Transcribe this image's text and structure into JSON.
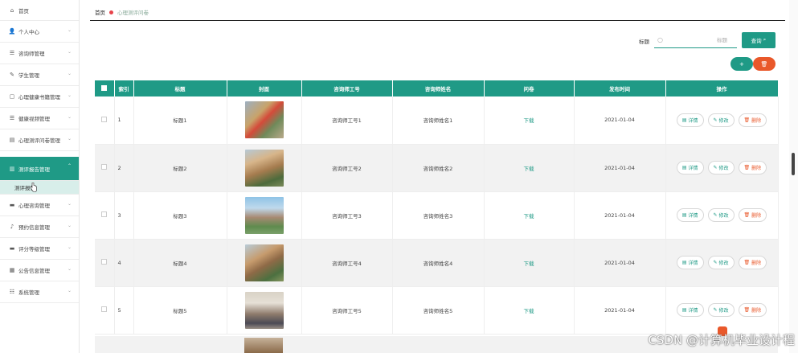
{
  "sidebar": {
    "home": "首页",
    "items": [
      {
        "label": "个人中心",
        "icon": "user-icon",
        "glyph": "👤"
      },
      {
        "label": "咨询师管理",
        "icon": "list-icon",
        "glyph": "☰"
      },
      {
        "label": "学生管理",
        "icon": "student-icon",
        "glyph": "✎"
      },
      {
        "label": "心理健康书籍管理",
        "icon": "book-icon",
        "glyph": "▢"
      },
      {
        "label": "健康视频管理",
        "icon": "video-icon",
        "glyph": "☰"
      },
      {
        "label": "心理测评问卷管理",
        "icon": "survey-icon",
        "glyph": "▤"
      }
    ],
    "active": {
      "label": "测评报告管理",
      "icon": "report-icon",
      "glyph": "▥"
    },
    "active_sub": "测评报告",
    "items_after": [
      {
        "label": "心理咨询管理",
        "icon": "chat-icon",
        "glyph": "▬"
      },
      {
        "label": "预约信息管理",
        "icon": "bell-icon",
        "glyph": "♪"
      },
      {
        "label": "评分等级管理",
        "icon": "star-icon",
        "glyph": "▬"
      },
      {
        "label": "公告信息管理",
        "icon": "notice-icon",
        "glyph": "▦"
      },
      {
        "label": "系统管理",
        "icon": "settings-icon",
        "glyph": "☷"
      }
    ]
  },
  "breadcrumb": {
    "home": "首页",
    "current": "心理测评问卷"
  },
  "search": {
    "label": "标题",
    "placeholder": "标题",
    "button": "查询"
  },
  "actions": {
    "add": "+",
    "delete": "🗑"
  },
  "table": {
    "headers": [
      "索引",
      "标题",
      "封面",
      "咨询师工号",
      "咨询师姓名",
      "问卷",
      "发布时间",
      "操作"
    ],
    "rows": [
      {
        "index": "1",
        "title": "标题1",
        "cover": "c1",
        "teacher_no": "咨询师工号1",
        "teacher_name": "咨询师姓名1",
        "file": "下载",
        "date": "2021-01-04"
      },
      {
        "index": "2",
        "title": "标题2",
        "cover": "c2",
        "teacher_no": "咨询师工号2",
        "teacher_name": "咨询师姓名2",
        "file": "下载",
        "date": "2021-01-04"
      },
      {
        "index": "3",
        "title": "标题3",
        "cover": "c3",
        "teacher_no": "咨询师工号3",
        "teacher_name": "咨询师姓名3",
        "file": "下载",
        "date": "2021-01-04"
      },
      {
        "index": "4",
        "title": "标题4",
        "cover": "c4",
        "teacher_no": "咨询师工号4",
        "teacher_name": "咨询师姓名4",
        "file": "下载",
        "date": "2021-01-04"
      },
      {
        "index": "5",
        "title": "标题5",
        "cover": "c5",
        "teacher_no": "咨询师工号5",
        "teacher_name": "咨询师姓名5",
        "file": "下载",
        "date": "2021-01-04"
      }
    ],
    "ops": {
      "detail": "详情",
      "edit": "修改",
      "delete": "删除"
    }
  },
  "watermark": "CSDN @计算机毕业设计程",
  "colors": {
    "primary": "#1f9a86",
    "danger": "#e9582a",
    "active_sub_bg": "#d8eeea"
  }
}
